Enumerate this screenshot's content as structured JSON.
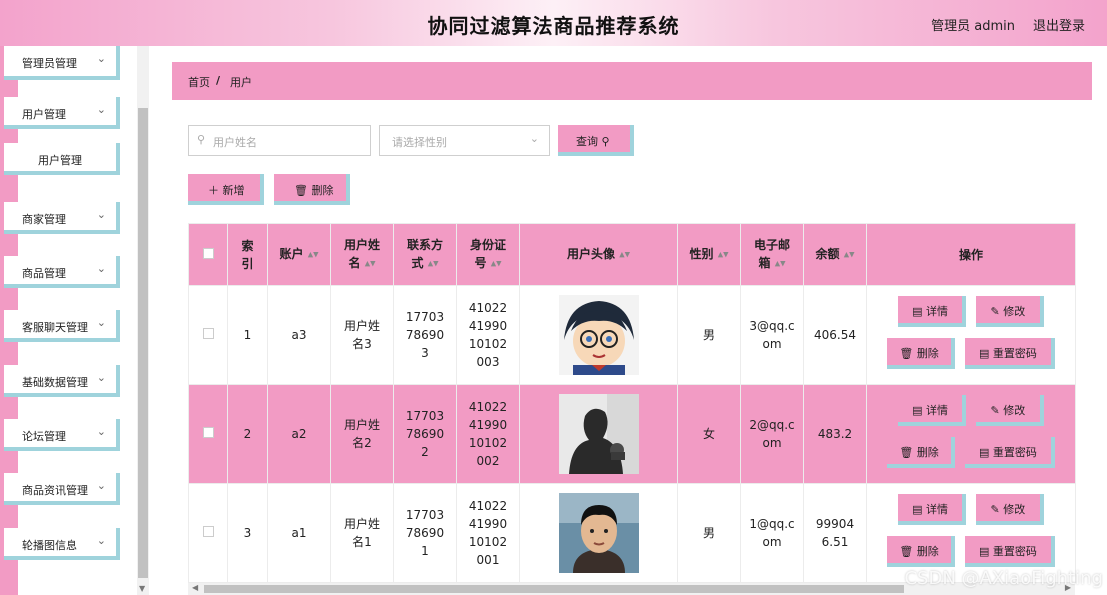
{
  "header": {
    "title": "协同过滤算法商品推荐系统",
    "user": "管理员 admin",
    "logout": "退出登录"
  },
  "sidebar": {
    "items": [
      {
        "label": "管理员管理",
        "top": 0
      },
      {
        "label": "用户管理"
      },
      {
        "label": "商家管理"
      },
      {
        "label": "商品管理"
      },
      {
        "label": "客服聊天管理"
      },
      {
        "label": "基础数据管理"
      },
      {
        "label": "论坛管理"
      },
      {
        "label": "商品资讯管理"
      },
      {
        "label": "轮播图信息"
      }
    ],
    "sub": "用户管理"
  },
  "breadcrumb": {
    "home": "首页",
    "sep": "/",
    "current": "用户"
  },
  "search": {
    "name_placeholder": "用户姓名",
    "gender_placeholder": "请选择性别",
    "query": "查询"
  },
  "toolbar": {
    "add": "新增",
    "delete": "删除"
  },
  "table": {
    "headers": {
      "index": "索引",
      "account": "账户",
      "name": "用户姓名",
      "phone": "联系方式",
      "idcard": "身份证号",
      "avatar": "用户头像",
      "gender": "性别",
      "email": "电子邮箱",
      "balance": "余额",
      "action": "操作"
    },
    "rows": [
      {
        "index": "1",
        "account": "a3",
        "name": "用户姓名3",
        "phone": "17703786903",
        "idcard": "410224199010102003",
        "gender": "男",
        "email": "3@qq.com",
        "balance": "406.54"
      },
      {
        "index": "2",
        "account": "a2",
        "name": "用户姓名2",
        "phone": "17703786902",
        "idcard": "410224199010102002",
        "gender": "女",
        "email": "2@qq.com",
        "balance": "483.2"
      },
      {
        "index": "3",
        "account": "a1",
        "name": "用户姓名1",
        "phone": "17703786901",
        "idcard": "410224199010102001",
        "gender": "男",
        "email": "1@qq.com",
        "balance": "999046.51"
      }
    ],
    "actions": {
      "detail": "详情",
      "edit": "修改",
      "delete": "删除",
      "reset": "重置密码"
    }
  },
  "watermark": "CSDN @AXiaoFighting",
  "colors": {
    "pink": "#f29bc4",
    "teal": "#9fd3dc"
  }
}
